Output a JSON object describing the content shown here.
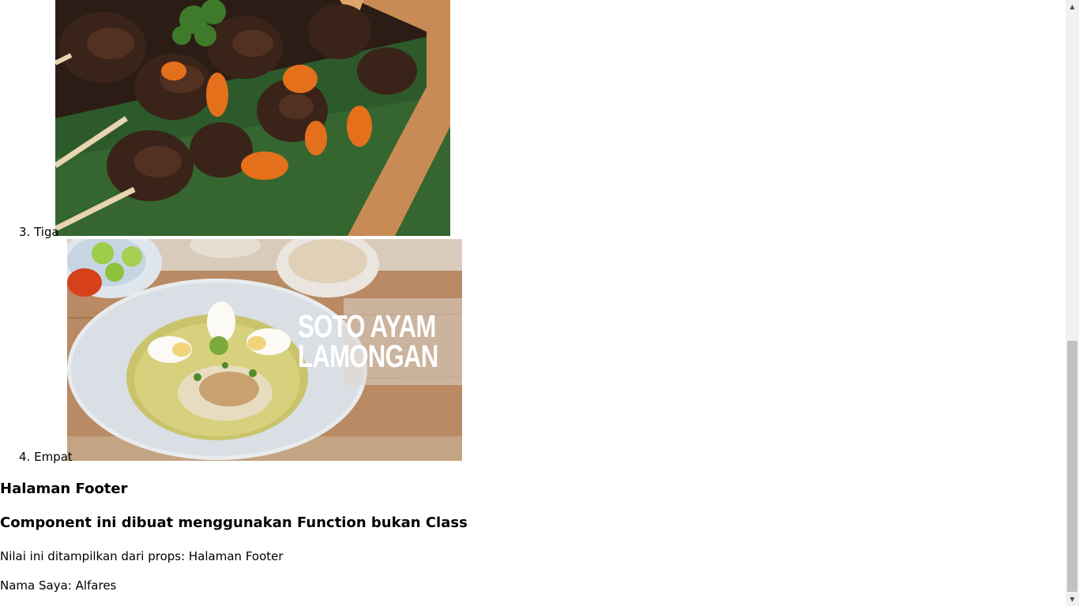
{
  "list": {
    "items": [
      {
        "number": "3.",
        "label": "Tiga",
        "image_name": "sate-image"
      },
      {
        "number": "4.",
        "label": "Empat",
        "image_name": "soto-image"
      }
    ]
  },
  "images": {
    "soto_title_line1": "SOTO AYAM",
    "soto_title_line2": "LAMONGAN"
  },
  "footer": {
    "heading": "Halaman Footer",
    "subheading": "Component ini dibuat menggunakan Function bukan Class",
    "props_text": "Nilai ini ditampilkan dari props: Halaman Footer",
    "name_text": "Nama Saya: Alfares"
  },
  "scrollbar": {
    "up_icon": "scroll-up-arrow-icon",
    "down_icon": "scroll-down-arrow-icon"
  },
  "colors": {
    "background": "#ffffff",
    "scroll_track": "#f1f1f1",
    "scroll_thumb": "#c1c1c1"
  }
}
